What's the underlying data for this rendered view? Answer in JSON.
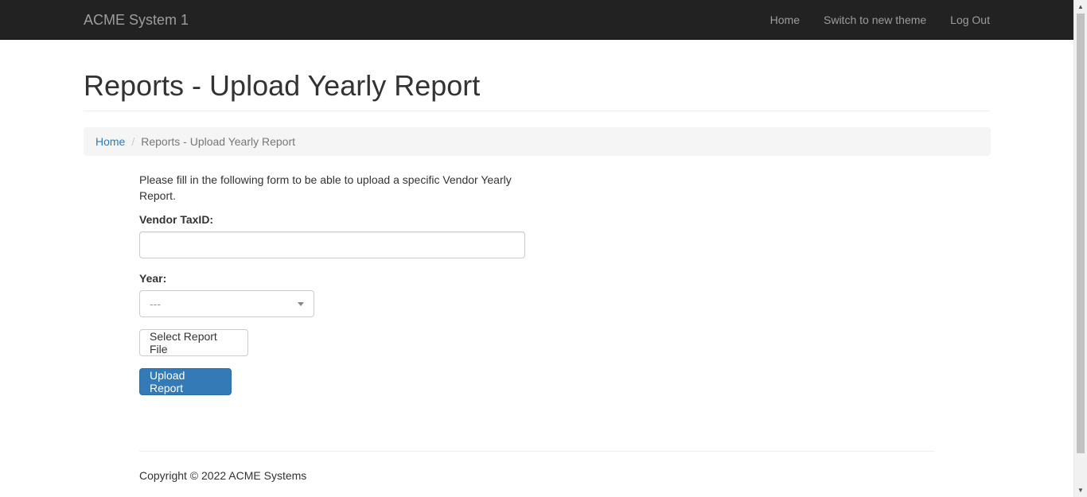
{
  "navbar": {
    "brand": "ACME System 1",
    "links": [
      "Home",
      "Switch to new theme",
      "Log Out"
    ]
  },
  "page": {
    "title": "Reports - Upload Yearly Report"
  },
  "breadcrumb": {
    "home": "Home",
    "separator": "/",
    "current": "Reports - Upload Yearly Report"
  },
  "form": {
    "intro": "Please fill in the following form to be able to upload a specific Vendor Yearly Report.",
    "vendor_label": "Vendor TaxID:",
    "vendor_value": "",
    "year_label": "Year:",
    "year_selected": "---",
    "select_file_label": "Select Report File",
    "upload_label": "Upload Report"
  },
  "footer": {
    "copyright": "Copyright © 2022 ACME Systems"
  },
  "colors": {
    "navbar_bg": "#222222",
    "link": "#337ab7",
    "primary": "#337ab7"
  }
}
